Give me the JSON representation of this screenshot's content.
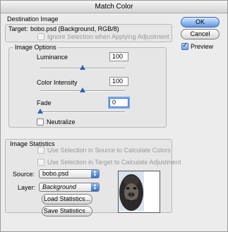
{
  "window": {
    "title": "Match Color"
  },
  "destination": {
    "group_label": "Destination Image",
    "target_label": "Target:",
    "target_value": "bobo.psd (Background, RGB/8)",
    "ignore_selection_label": "Ignore Selection when Applying Adjustment"
  },
  "image_options": {
    "group_label": "Image Options",
    "luminance": {
      "label": "Luminance",
      "value": "100"
    },
    "color_intensity": {
      "label": "Color Intensity",
      "value": "100"
    },
    "fade": {
      "label": "Fade",
      "value": "0"
    },
    "neutralize_label": "Neutralize"
  },
  "statistics": {
    "group_label": "Image Statistics",
    "use_source_label": "Use Selection in Source to Calculate Colors",
    "use_target_label": "Use Selection in Target to Calculate Adjustment",
    "source_label": "Source:",
    "source_value": "bobo.psd",
    "layer_label": "Layer:",
    "layer_value": "Background",
    "load_button": "Load Statistics...",
    "save_button": "Save Statistics..."
  },
  "buttons": {
    "ok": "OK",
    "cancel": "Cancel"
  },
  "preview": {
    "label": "Preview",
    "checked": true
  },
  "icons": {
    "popup_arrows": "updown-arrows-icon",
    "checkmark": "checkmark-icon",
    "slider_thumb": "triangle-thumb-icon"
  },
  "colors": {
    "accent": "#2e63b8",
    "default_button": "#5f97e3"
  }
}
